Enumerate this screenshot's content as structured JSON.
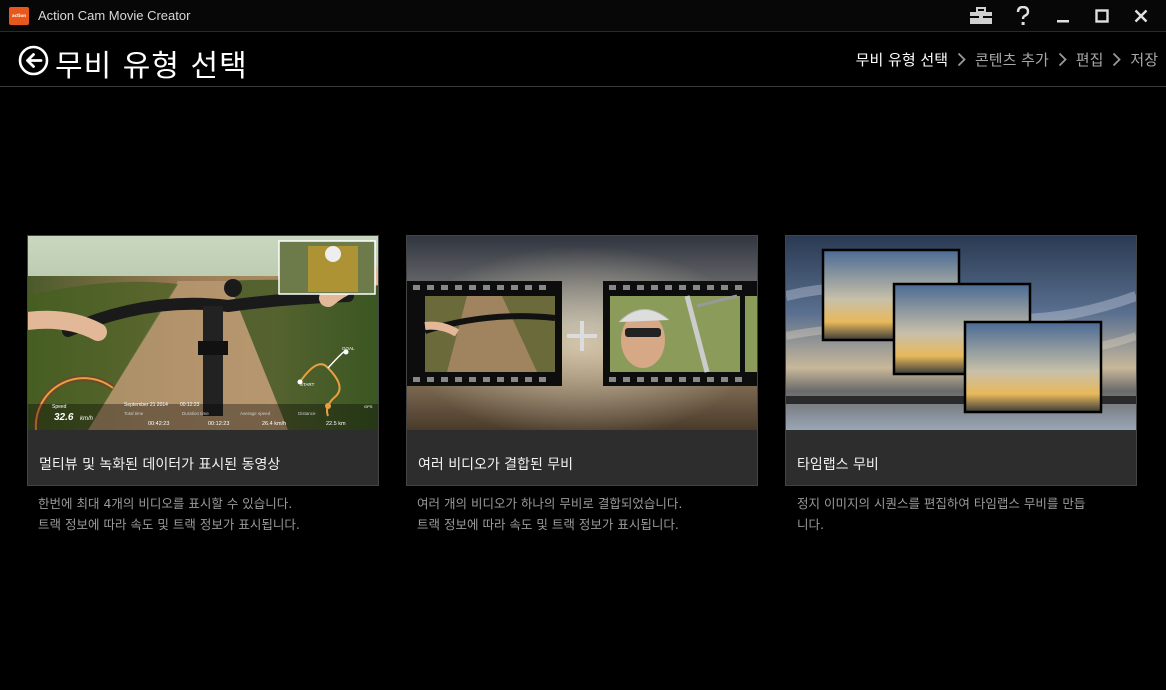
{
  "window": {
    "logo_text": "action",
    "title": "Action Cam Movie Creator"
  },
  "header": {
    "page_title": "무비 유형 선택",
    "steps": [
      {
        "label": "무비 유형 선택",
        "active": true
      },
      {
        "label": "콘텐츠 추가",
        "active": false
      },
      {
        "label": "편집",
        "active": false
      },
      {
        "label": "저장",
        "active": false
      }
    ]
  },
  "cards": [
    {
      "label": "멀티뷰 및 녹화된 데이터가 표시된 동영상",
      "desc_line1": "한번에 최대 4개의 비디오를 표시할 수 있습니다.",
      "desc_line2": "트랙 정보에 따라 속도 및 트랙 정보가 표시됩니다.",
      "overlay": {
        "speed_label": "Speed",
        "speed_value": "32.6",
        "speed_unit": "km/h",
        "date": "September 21 2014",
        "clock": "00:12:23",
        "total_time_label": "Total time",
        "total_time": "00:42:23",
        "duration_label": "Duration time",
        "duration": "00:12:23",
        "avg_speed_label": "Average speed",
        "avg_speed": "26.4 km/h",
        "distance_label": "Distance",
        "distance": "22.5 km",
        "goal_label": "GOAL",
        "start_label": "START",
        "gps_label": "GPS"
      }
    },
    {
      "label": "여러 비디오가 결합된 무비",
      "desc_line1": "여러 개의 비디오가 하나의 무비로 결합되었습니다.",
      "desc_line2": "트랙 정보에 따라 속도 및 트랙 정보가 표시됩니다."
    },
    {
      "label": "타임랩스 무비",
      "desc_line1": "정지 이미지의 시퀀스를 편집하여 타임랩스 무비를 만듭",
      "desc_line2": "니다."
    }
  ],
  "colors": {
    "background": "#000000",
    "card": "#2d2d2d",
    "logo": "#e8581c",
    "route": "#e8a040"
  },
  "icons": [
    "toolbox-icon",
    "help-icon",
    "minimize-icon",
    "maximize-icon",
    "close-icon",
    "back-arrow-icon",
    "chevron-right-icon"
  ]
}
